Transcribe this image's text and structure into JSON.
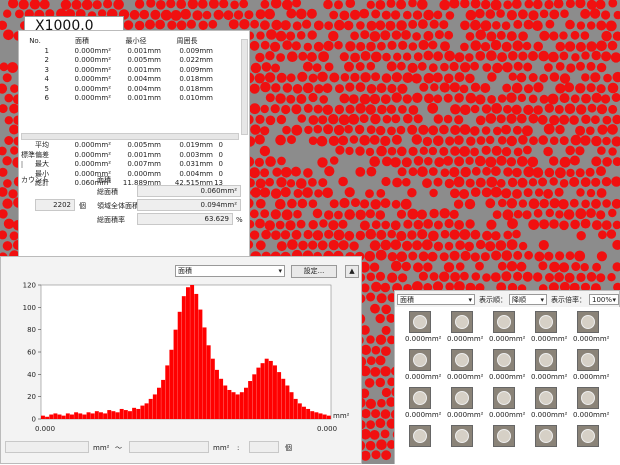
{
  "zoom_label": "X1000.0",
  "table": {
    "headers": [
      "No.",
      "面積",
      "最小径",
      "周囲長"
    ],
    "rows": [
      [
        "1",
        "0.000mm²",
        "0.001mm",
        "0.009mm"
      ],
      [
        "2",
        "0.000mm²",
        "0.005mm",
        "0.022mm"
      ],
      [
        "3",
        "0.000mm²",
        "0.001mm",
        "0.009mm"
      ],
      [
        "4",
        "0.000mm²",
        "0.004mm",
        "0.018mm"
      ],
      [
        "5",
        "0.000mm²",
        "0.004mm",
        "0.018mm"
      ],
      [
        "6",
        "0.000mm²",
        "0.001mm",
        "0.010mm"
      ]
    ],
    "stats": [
      [
        "平均",
        "0.000mm²",
        "0.005mm",
        "0.019mm",
        "0"
      ],
      [
        "標準偏差",
        "0.000mm²",
        "0.001mm",
        "0.003mm",
        "0"
      ],
      [
        "最大",
        "0.000mm²",
        "0.007mm",
        "0.031mm",
        "0"
      ],
      [
        "最小",
        "0.000mm²",
        "0.000mm",
        "0.004mm",
        "0"
      ],
      [
        "総計",
        "0.060mm²",
        "11.889mm",
        "42.515mm",
        "13"
      ]
    ]
  },
  "summary": {
    "count_label": "カウント",
    "count_value": "2202",
    "count_unit": "個",
    "area_header": "面積",
    "total_area_label": "総面積",
    "total_area_value": "0.060mm²",
    "region_area_label": "領域全体面積",
    "region_area_value": "0.094mm²",
    "ratio_label": "総面積率",
    "ratio_value": "63.629",
    "ratio_unit": "%"
  },
  "histogram": {
    "select_value": "面積",
    "settings_button": "設定...",
    "collapse_icon": "triangle-up-icon",
    "unit_label": "mm²",
    "range_unit1": "mm²",
    "range_sep": "～",
    "range_unit2": "mm²",
    "range_colon": ":",
    "range_count_unit": "個"
  },
  "chart_data": {
    "type": "bar",
    "title": "",
    "xlabel": "mm²",
    "ylabel": "",
    "ylim": [
      0,
      120
    ],
    "yticks": [
      "0",
      "20",
      "40",
      "60",
      "80",
      "100",
      "120"
    ],
    "xtick_labels": [
      "0.000",
      "0.000"
    ],
    "color": "#ff0000",
    "values": [
      3,
      2,
      4,
      5,
      4,
      3,
      5,
      4,
      6,
      5,
      4,
      6,
      5,
      7,
      6,
      5,
      8,
      7,
      6,
      9,
      8,
      7,
      10,
      9,
      12,
      14,
      18,
      22,
      28,
      35,
      48,
      62,
      80,
      96,
      110,
      118,
      120,
      112,
      98,
      82,
      66,
      54,
      44,
      36,
      30,
      26,
      24,
      22,
      24,
      28,
      34,
      40,
      46,
      50,
      54,
      52,
      48,
      42,
      36,
      30,
      24,
      18,
      14,
      11,
      9,
      7,
      6,
      5,
      4,
      3
    ]
  },
  "thumbnails": {
    "select1": "面積",
    "order_label": "表示順：",
    "order_value": "降順",
    "scale_label": "表示倍率：",
    "scale_value": "100%",
    "item_label": "0.000mm²"
  }
}
